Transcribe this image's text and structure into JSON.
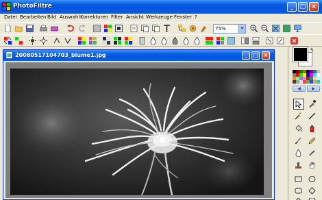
{
  "app": {
    "title": "PhotoFiltre",
    "window_buttons": [
      "_",
      "□",
      "×"
    ]
  },
  "menu": [
    "Datei",
    "Bearbeiten",
    "Bild",
    "Auswahl",
    "Korrekturen",
    "Filter",
    "Ansicht",
    "Werkzeuge",
    "Fenster",
    "?"
  ],
  "toolbar": {
    "zoom_value": "75%",
    "row1_icons": [
      "new-icon",
      "open-icon",
      "save-icon",
      "print-icon",
      "scan-icon",
      "undo-icon",
      "redo-icon",
      "canvas-icon",
      "color-depth-icon",
      "image-size-icon",
      "canvas-size-icon",
      "copy-icon",
      "text-icon",
      "tree-icon",
      "plugin-icon",
      "zoom-in-icon",
      "zoom-out-icon",
      "fit-icon",
      "fullscreen-icon",
      "screen-icon"
    ],
    "row2_icons": [
      "auto-levels-icon",
      "auto-contrast-icon",
      "brightness-up-icon",
      "brightness-down-icon",
      "contrast-up-icon",
      "contrast-down-icon",
      "saturation-up-icon",
      "saturation-down-icon",
      "gamma-up-icon",
      "gamma-down-icon",
      "blur-icon",
      "sharpen-icon",
      "drop-icon",
      "drop2-icon",
      "drop3-icon",
      "color-balance-icon",
      "grayscale-icon",
      "sepia-icon",
      "flip-h-icon",
      "flip-v-icon",
      "rotate-icon",
      "close-image-icon"
    ]
  },
  "document": {
    "title": "20080517104703_blume1.jpg"
  },
  "colors": {
    "titlebar": "#0054e3",
    "foreground": "#000000",
    "background": "#ffffff"
  }
}
